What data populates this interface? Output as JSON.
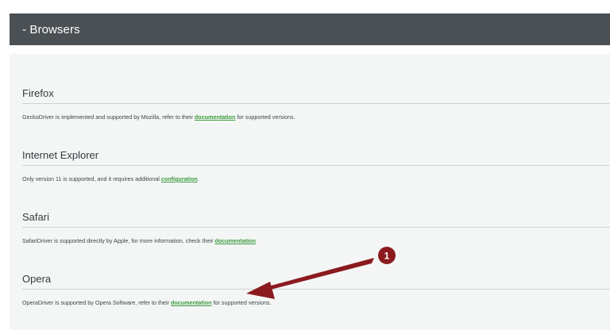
{
  "header": {
    "title": "- Browsers"
  },
  "sections": [
    {
      "heading": "Firefox",
      "text_before": "GeckoDriver is implemented and supported by Mozilla, refer to their ",
      "link": "documentation",
      "text_after": " for supported versions."
    },
    {
      "heading": "Internet Explorer",
      "text_before": "Only version 11 is supported, and it requires additional ",
      "link": "configuration",
      "text_after": "."
    },
    {
      "heading": "Safari",
      "text_before": "SafariDriver is supported directly by Apple, for more information, check their ",
      "link": "documentation",
      "text_after": ""
    },
    {
      "heading": "Opera",
      "text_before": "OperaDriver is supported by Opera Software, refer to their ",
      "link": "documentation",
      "text_after": " for supported versions."
    }
  ],
  "annotation": {
    "badge_label": "1",
    "color": "#8b1a1f"
  },
  "colors": {
    "header_bg": "#4b5054",
    "panel_bg": "#f4f6f5",
    "link": "#3a9b3e"
  }
}
